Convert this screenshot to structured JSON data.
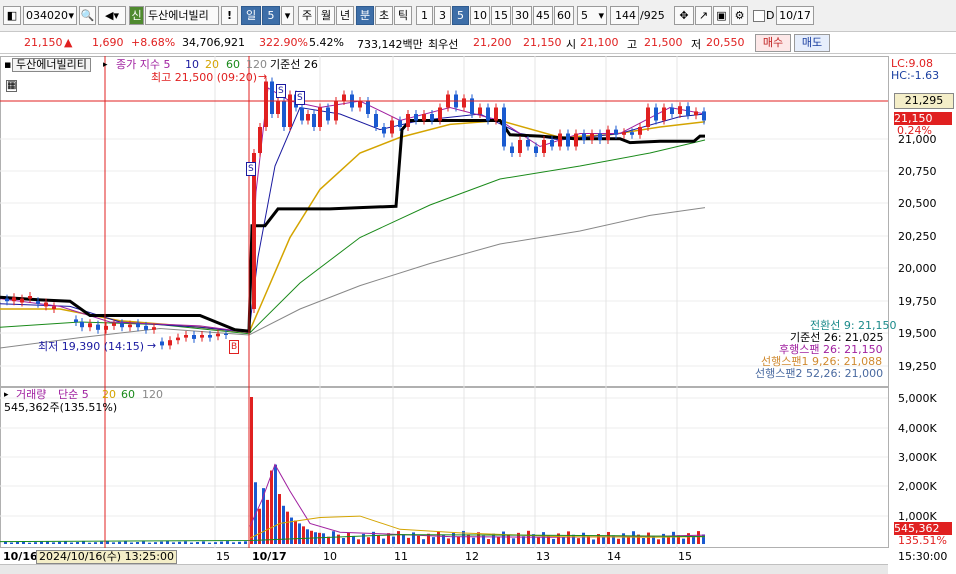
{
  "toolbar": {
    "code": "034020",
    "badge": "신",
    "name": "두산에너빌리",
    "warn": "!",
    "period_sel": "일",
    "period_num": "5",
    "periods": [
      "주",
      "월",
      "년",
      "분",
      "초",
      "틱"
    ],
    "minutes": [
      "1",
      "3",
      "5",
      "10",
      "15",
      "30",
      "45",
      "60"
    ],
    "count": "5",
    "range": "144",
    "range_total": "/925",
    "check_label": "D",
    "date": "10/17"
  },
  "quote": {
    "price": "21,150",
    "arrow": "▲",
    "change": "1,690",
    "change_pct": "+8.68%",
    "volume": "34,706,921",
    "vol_ratio": "322.90%",
    "turnover": "5.42%",
    "amount": "733,142백만",
    "best_label": "최우선",
    "best_ask": "21,200",
    "best_bid": "21,150",
    "open_label": "시",
    "open": "21,100",
    "high_label": "고",
    "high": "21,500",
    "low_label": "저",
    "low": "20,550",
    "buy": "매수",
    "sell": "매도"
  },
  "price_panel": {
    "stock_label": "두산에너빌리티",
    "legend_prefix": "종가 지수 5",
    "legend_values": [
      "10",
      "20",
      "60",
      "120"
    ],
    "legend_colors": [
      "#1a1aa0",
      "#d4a400",
      "#1a8a1a",
      "#888888"
    ],
    "ichimoku_label": "기준선 26",
    "high_note": "최고 21,500 (09:20)",
    "low_note": "최저 19,390 (14:15)",
    "lc": "LC:9.08",
    "hc": "HC:-1.63",
    "current_box": "21,295",
    "price_box": "21,150",
    "pct_box": "0.24%",
    "ichimoku_values": [
      {
        "text": "전환선 9: 21,150",
        "color": "#1a8a8a"
      },
      {
        "text": "기준선 26: 21,025",
        "color": "#000000"
      },
      {
        "text": "후행스팬 26: 21,150",
        "color": "#a020a0"
      },
      {
        "text": "선행스팬1 9,26: 21,088",
        "color": "#d08a30"
      },
      {
        "text": "선행스팬2 52,26: 21,000",
        "color": "#4a6aa0"
      }
    ],
    "y_ticks": [
      "21,000",
      "20,750",
      "20,500",
      "20,250",
      "20,000",
      "19,750",
      "19,500",
      "19,250"
    ]
  },
  "volume_panel": {
    "title": "거래량",
    "legend_prefix": "단순 5",
    "legend_values": [
      "20",
      "60",
      "120"
    ],
    "legend_colors": [
      "#d4a400",
      "#1a8a1a",
      "#888888"
    ],
    "summary": "545,362주(135.51%)",
    "y_ticks": [
      "5,000K",
      "4,000K",
      "3,000K",
      "2,000K",
      "1,000K"
    ],
    "vol_box": "545,362",
    "pct_box": "135.51%"
  },
  "x_axis": {
    "labels": [
      "10/16",
      "15",
      "10/17",
      "10",
      "11",
      "12",
      "13",
      "14",
      "15"
    ],
    "cursor_time": "2024/10/16(수) 13:25:00",
    "right_time": "15:30:00"
  },
  "chart_data": {
    "type": "candlestick",
    "interval": "5분",
    "high": 21500,
    "low": 19390,
    "last": 21150,
    "ylim": [
      19150,
      21650
    ],
    "volume_ylim": [
      0,
      5200
    ]
  }
}
